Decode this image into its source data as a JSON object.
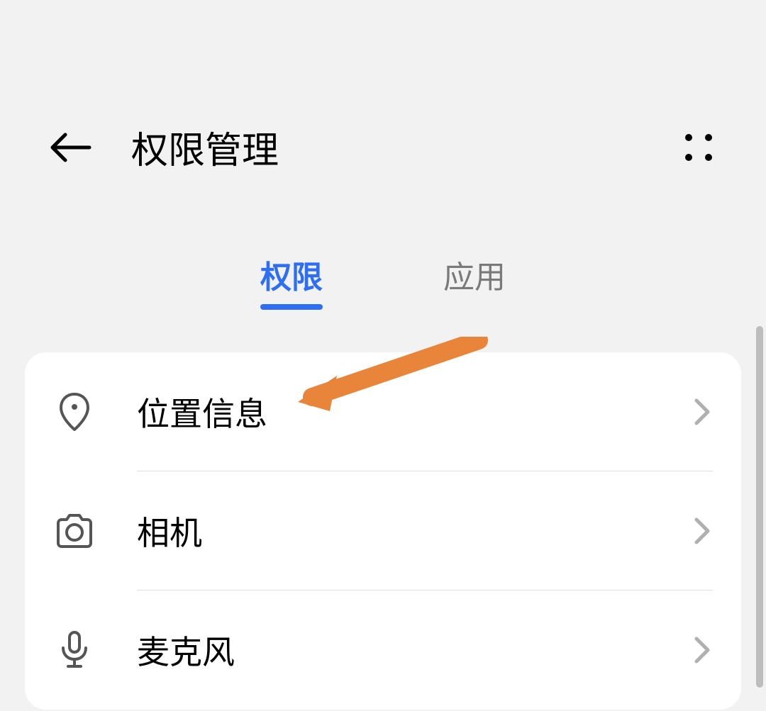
{
  "header": {
    "title": "权限管理"
  },
  "tabs": {
    "permissions": "权限",
    "apps": "应用",
    "active": "permissions"
  },
  "items": [
    {
      "icon": "location-icon",
      "label": "位置信息"
    },
    {
      "icon": "camera-icon",
      "label": "相机"
    },
    {
      "icon": "microphone-icon",
      "label": "麦克风"
    }
  ],
  "annotation": {
    "arrow_color": "#e8853a"
  }
}
